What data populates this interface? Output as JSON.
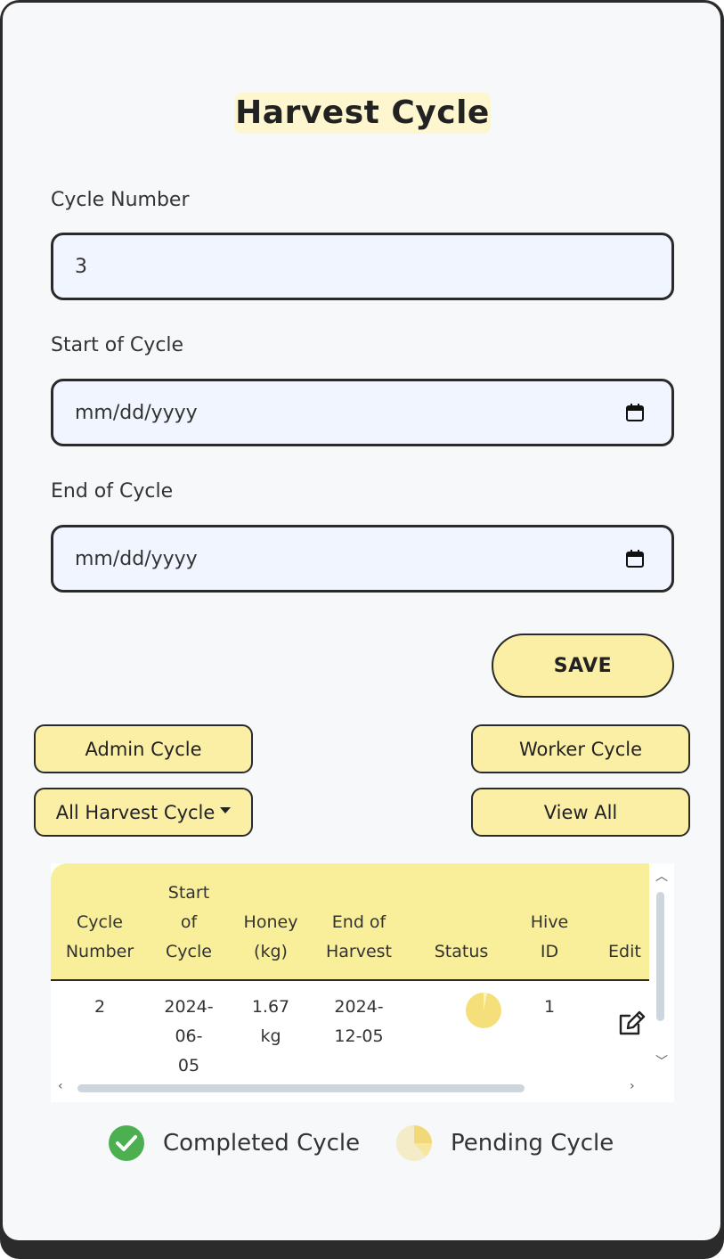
{
  "title": "Harvest Cycle",
  "form": {
    "cycle_number_label": "Cycle Number",
    "cycle_number_value": "3",
    "start_label": "Start of Cycle",
    "start_placeholder": "mm/dd/yyyy",
    "end_label": "End of Cycle",
    "end_placeholder": "mm/dd/yyyy",
    "save_label": "SAVE"
  },
  "buttons": {
    "admin_cycle": "Admin Cycle",
    "worker_cycle": "Worker Cycle",
    "filter_dropdown": "All Harvest Cycle",
    "view_all": "View All"
  },
  "table": {
    "headers": {
      "cycle_number": [
        "Cycle",
        "Number"
      ],
      "start_of_cycle": [
        "Start",
        "of",
        "Cycle"
      ],
      "honey": [
        "Honey",
        "(kg)"
      ],
      "end_of_harvest": [
        "End of",
        "Harvest"
      ],
      "status": "Status",
      "hive_id": [
        "Hive",
        "ID"
      ],
      "edit": "Edit"
    },
    "rows": [
      {
        "cycle_number": "2",
        "start": [
          "2024-",
          "06-",
          "05"
        ],
        "honey": [
          "1.67",
          "kg"
        ],
        "end": [
          "2024-",
          "12-05"
        ],
        "status": "pending",
        "hive_id": "1"
      }
    ]
  },
  "legend": {
    "completed": "Completed Cycle",
    "pending": "Pending Cycle"
  },
  "colors": {
    "accent_yellow": "#fbefa6",
    "header_yellow": "#f9ee9a",
    "pending": "#f5df7a",
    "completed": "#4caf50",
    "input_bg": "#f0f5ff"
  }
}
